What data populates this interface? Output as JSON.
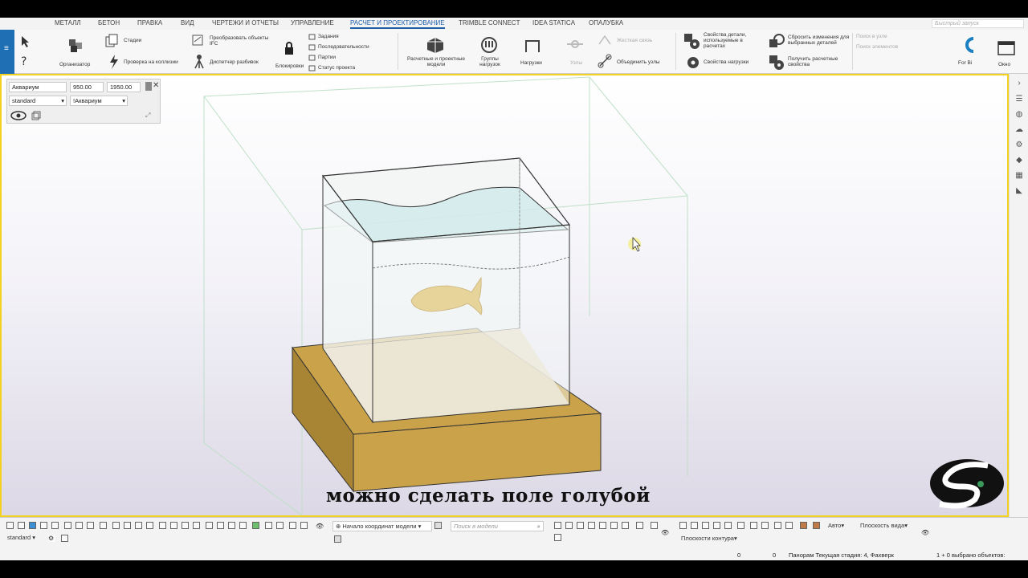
{
  "menu": {
    "tabs": [
      "МЕТАЛЛ",
      "БЕТОН",
      "ПРАВКА",
      "ВИД",
      "ЧЕРТЕЖИ И ОТЧЕТЫ",
      "УПРАВЛЕНИЕ",
      "РАСЧЕТ И ПРОЕКТИРОВАНИЕ",
      "TRIMBLE CONNECT",
      "IDEA STATICA",
      "ОПАЛУБКА"
    ],
    "active_tab": "РАСЧЕТ И ПРОЕКТИРОВАНИЕ",
    "quick_launch_placeholder": "Быстрый запуск"
  },
  "ribbon": {
    "organizer": "Организатор",
    "stages": "Стадии",
    "collision_check": "Проверка на коллизии",
    "convert_ifc": "Преобразовать объекты IFC",
    "layout_manager": "Диспетчер разбивок",
    "locks": "Блокировки",
    "tasks": "Задания",
    "sequences": "Последовательности",
    "lots": "Партии",
    "project_status": "Статус проекта",
    "analysis_models": "Расчетные и проектные модели",
    "load_groups": "Группы нагрузок",
    "loads": "Нагрузки",
    "nodes": "Узлы",
    "rigid_link": "Жесткая связь",
    "merge_nodes": "Объединить узлы",
    "part_properties_used": "Свойства детали, используемые в расчетах",
    "load_properties": "Свойства нагрузки",
    "reset_changes": "Сбросить изменения для выбранных деталей",
    "get_analysis_props": "Получить расчетные свойства",
    "node_search": "Поиск в узле",
    "element_search": "Поиск элементов",
    "for_bim": "For Bi",
    "window": "Окно"
  },
  "props_panel": {
    "name": "Аквариум",
    "value1": "950.00",
    "value2": "1950.00",
    "preset": "standard",
    "preset2": "!Аквариум"
  },
  "viewport": {
    "subtitle": "можно сделать поле голубой",
    "colors": {
      "wood": "#c9a24a",
      "wood_dark": "#a88535",
      "water": "#cfeaea",
      "glass_edge": "#333333",
      "fish": "#e7d49a",
      "border": "#f2d21f"
    }
  },
  "bottom": {
    "filter_value": "standard",
    "coord_origin": "Начало координат модели",
    "search_placeholder": "Поиск в модели",
    "auto": "Авто",
    "view_plane": "Плоскость вида",
    "contour_planes": "Плоскости контура"
  },
  "status": {
    "x_val": "0",
    "y_val": "0",
    "stage": "Панорам Текущая стадия: 4, Фахверк",
    "selection": "1 + 0 выбрано объектов:"
  }
}
